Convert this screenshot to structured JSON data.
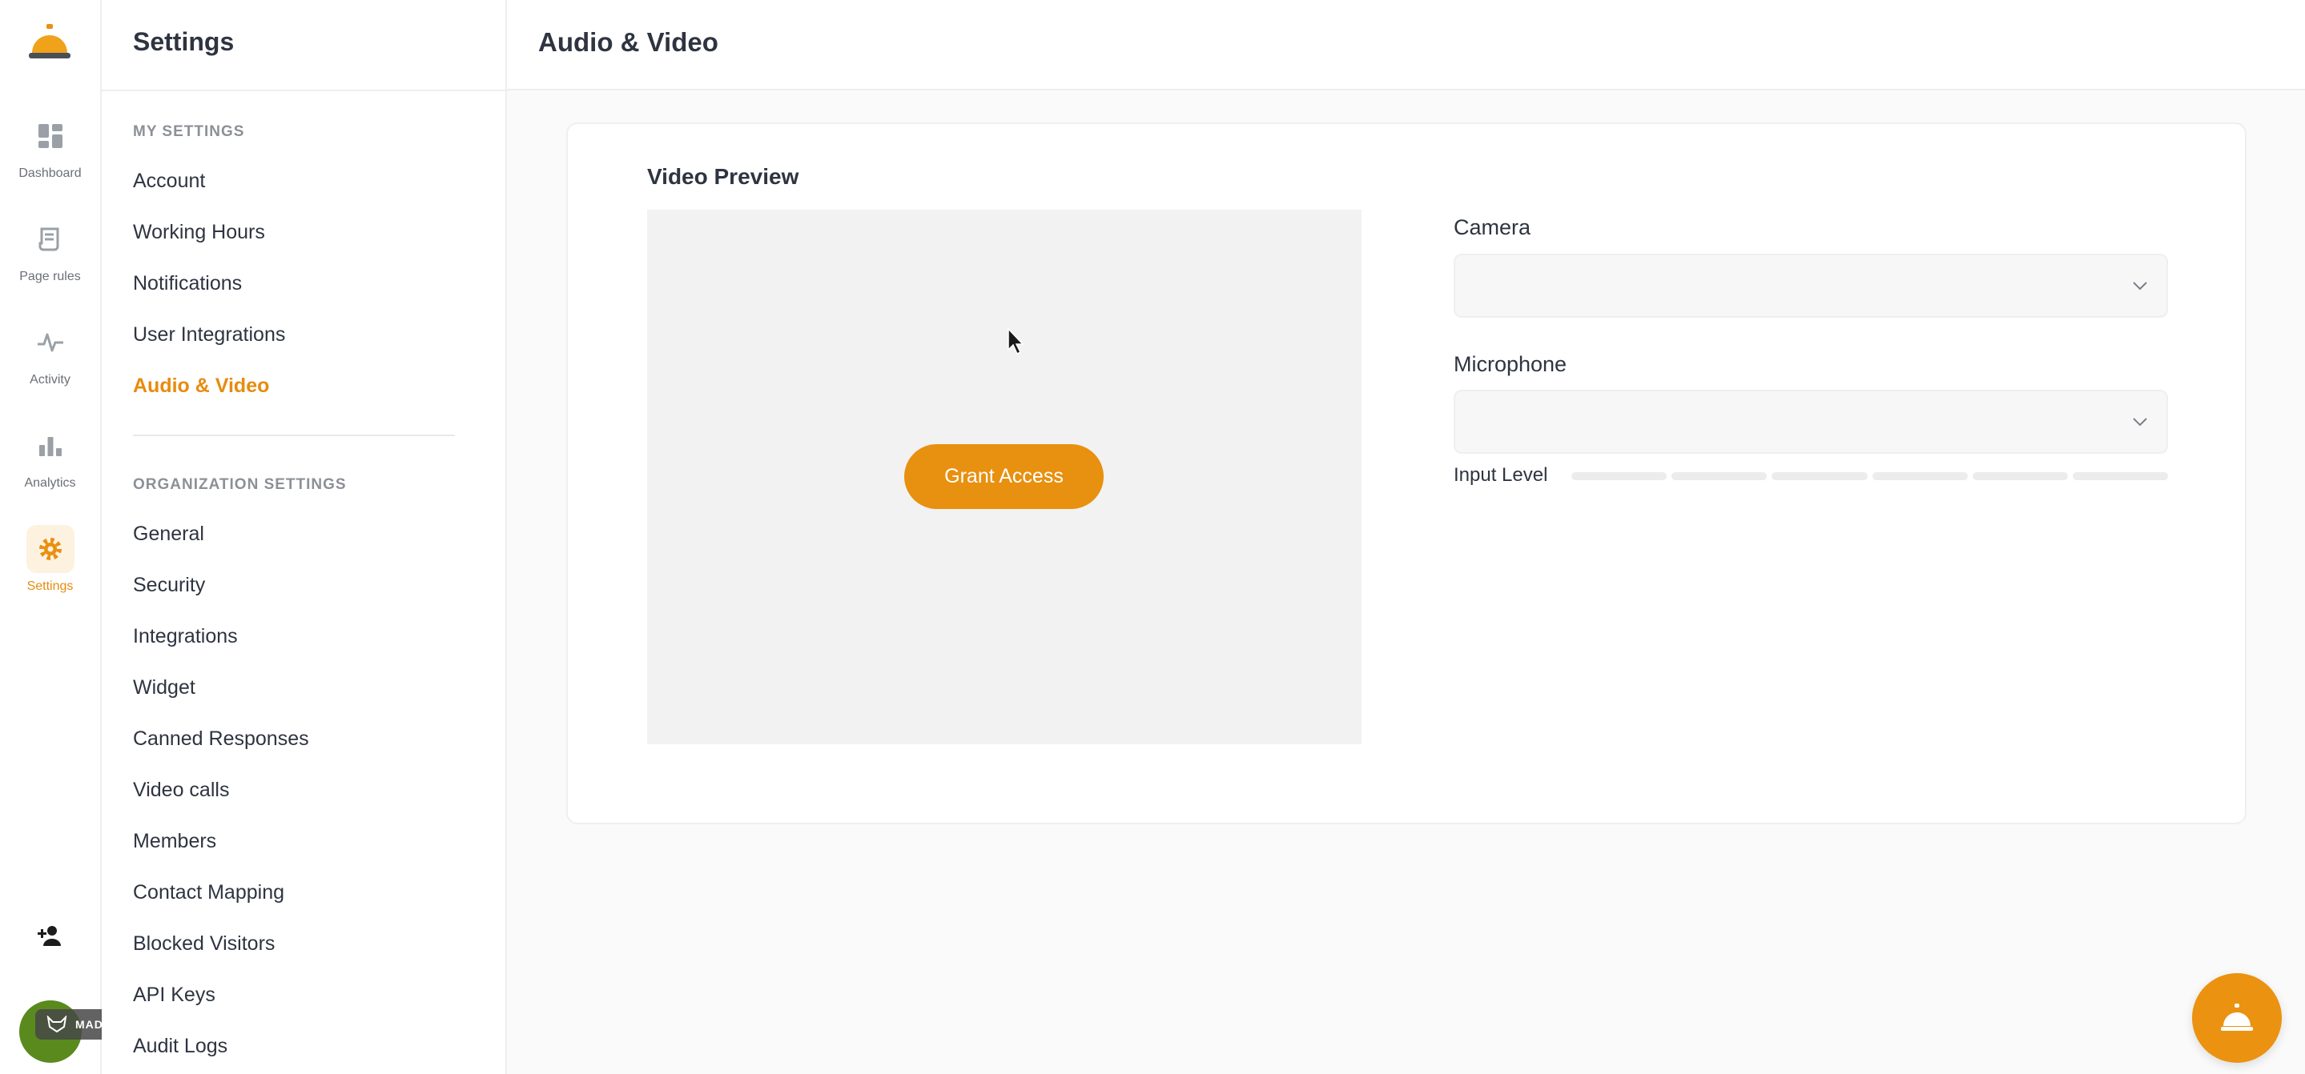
{
  "app": {
    "logo_icon": "service-bell-icon",
    "accent_color": "#e8900f"
  },
  "rail": {
    "items": [
      {
        "label": "Dashboard",
        "icon": "dashboard-icon"
      },
      {
        "label": "Page rules",
        "icon": "scroll-icon"
      },
      {
        "label": "Activity",
        "icon": "pulse-icon"
      },
      {
        "label": "Analytics",
        "icon": "bar-chart-icon"
      },
      {
        "label": "Settings",
        "icon": "gear-icon"
      }
    ],
    "add_user_icon": "add-user-icon",
    "gifox_badge": "MADE WITH GIFOX"
  },
  "sidebar": {
    "title": "Settings",
    "my_settings_label": "MY SETTINGS",
    "my_settings": [
      "Account",
      "Working Hours",
      "Notifications",
      "User Integrations",
      "Audio & Video"
    ],
    "org_settings_label": "ORGANIZATION SETTINGS",
    "org_settings": [
      "General",
      "Security",
      "Integrations",
      "Widget",
      "Canned Responses",
      "Video calls",
      "Members",
      "Contact Mapping",
      "Blocked Visitors",
      "API Keys",
      "Audit Logs"
    ]
  },
  "main": {
    "page_title": "Audio & Video",
    "video_preview_title": "Video Preview",
    "grant_access_label": "Grant Access",
    "camera_label": "Camera",
    "camera_value": "",
    "microphone_label": "Microphone",
    "microphone_value": "",
    "input_level_label": "Input Level",
    "input_level": 0
  },
  "fab_icon": "service-bell-icon"
}
